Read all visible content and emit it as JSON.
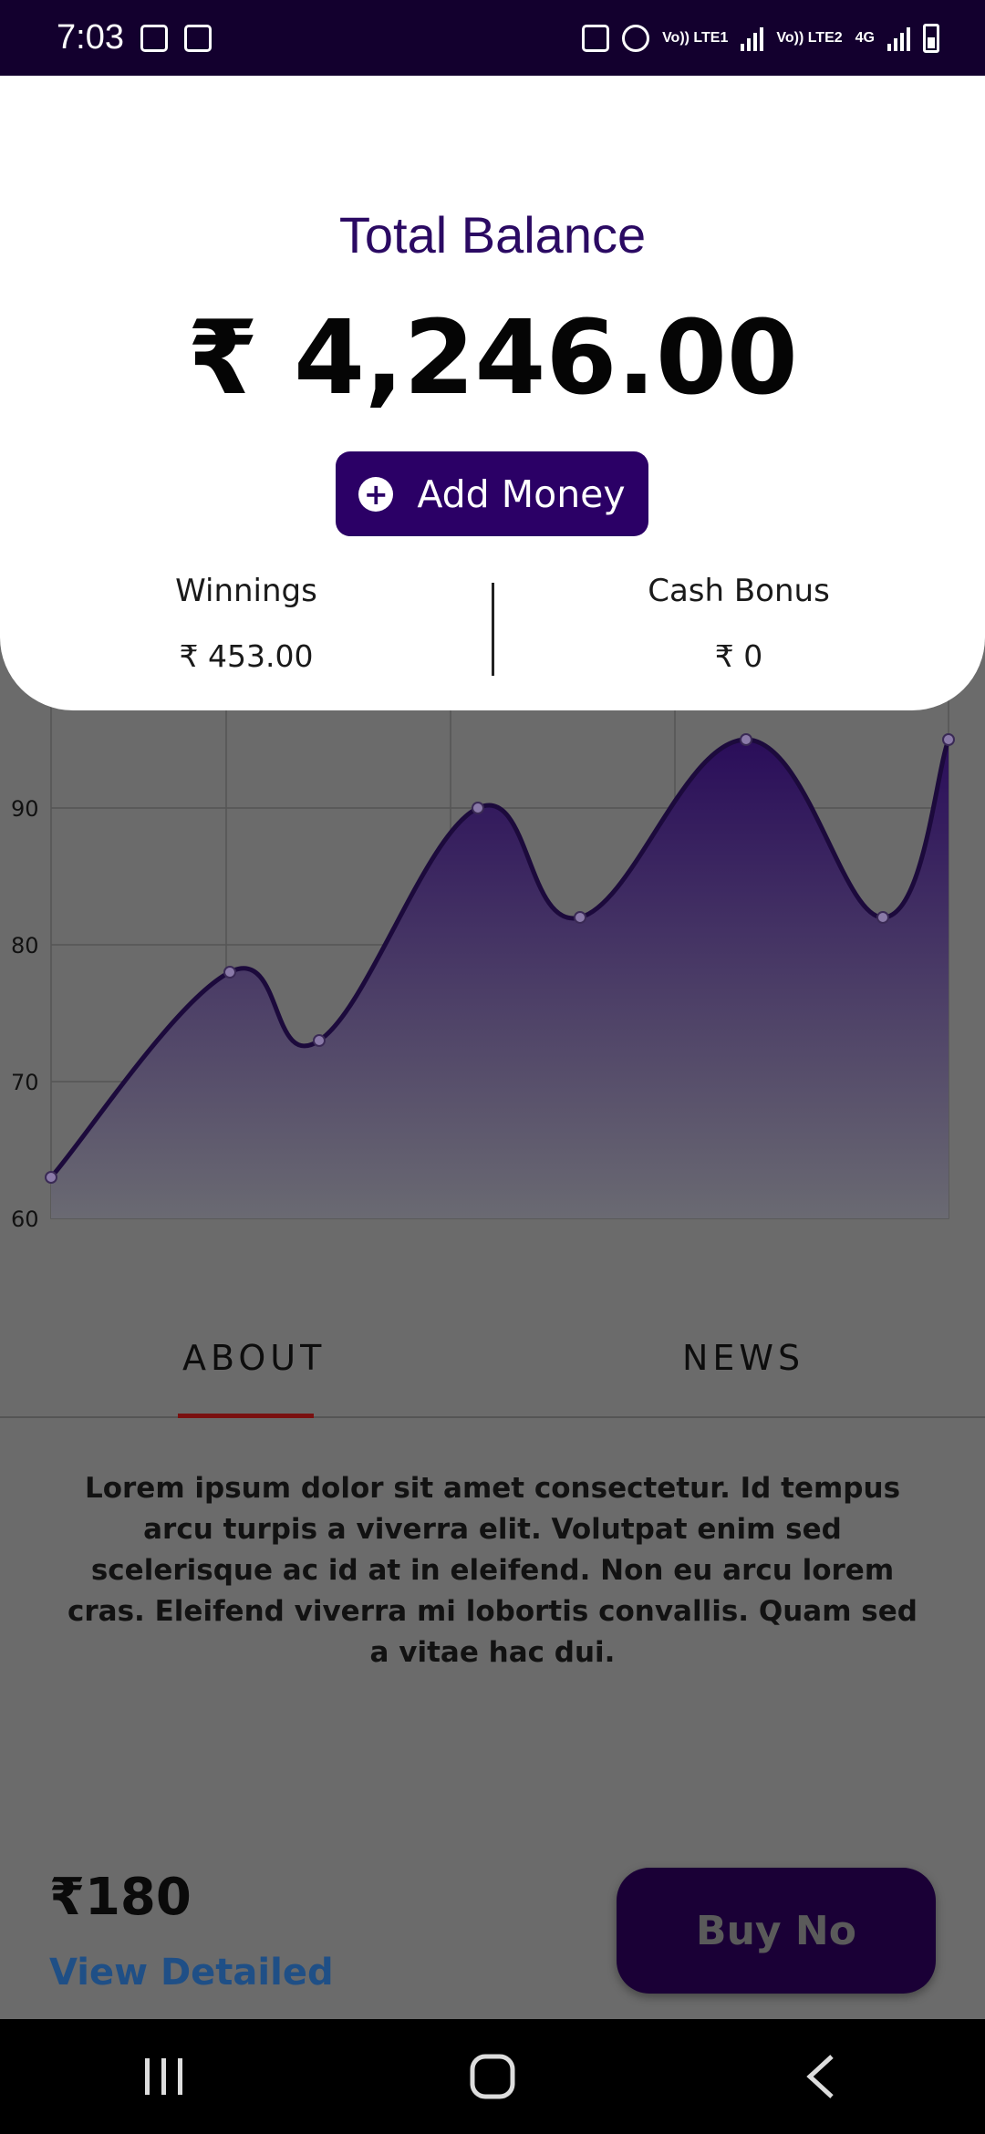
{
  "status_bar": {
    "time": "7:03",
    "net1": "Vo)) LTE1",
    "net2": "Vo)) LTE2",
    "net3": "4G"
  },
  "balance": {
    "title": "Total Balance",
    "amount": "₹ 4,246.00",
    "add_money_label": "Add Money",
    "winnings_label": "Winnings",
    "winnings_value": "₹ 453.00",
    "cash_bonus_label": "Cash Bonus",
    "cash_bonus_value": "₹ 0"
  },
  "chart_data": {
    "type": "area",
    "x": [
      0,
      1,
      2,
      3,
      4,
      5,
      6,
      7
    ],
    "values": [
      63,
      78,
      73,
      90,
      82,
      95,
      82,
      95
    ],
    "y_ticks": [
      "60",
      "70",
      "80",
      "90"
    ],
    "ylim": [
      60,
      95
    ],
    "grid": true,
    "colors": {
      "line": "#1c0a3c",
      "fill_top": "#2a0d5a",
      "fill_bottom": "#6a6a72"
    }
  },
  "tabs": {
    "about": "ABOUT",
    "news": "NEWS",
    "active": "about"
  },
  "about_text": "Lorem ipsum dolor sit amet consectetur. Id tempus arcu turpis a viverra elit. Volutpat enim sed scelerisque ac id at in eleifend. Non eu arcu lorem cras. Eleifend viverra mi lobortis convallis. Quam sed a vitae hac dui.",
  "bottom": {
    "price": "₹180",
    "view_detailed": "View Detailed",
    "buy_label": "Buy No"
  },
  "colors": {
    "brand": "#2b0066",
    "status_bar": "#13002e",
    "accent_tab": "#7a1010",
    "link": "#1f4f86"
  },
  "icons": {
    "add": "plus-circle-icon",
    "nav": [
      "recents-icon",
      "home-icon",
      "back-icon"
    ]
  }
}
